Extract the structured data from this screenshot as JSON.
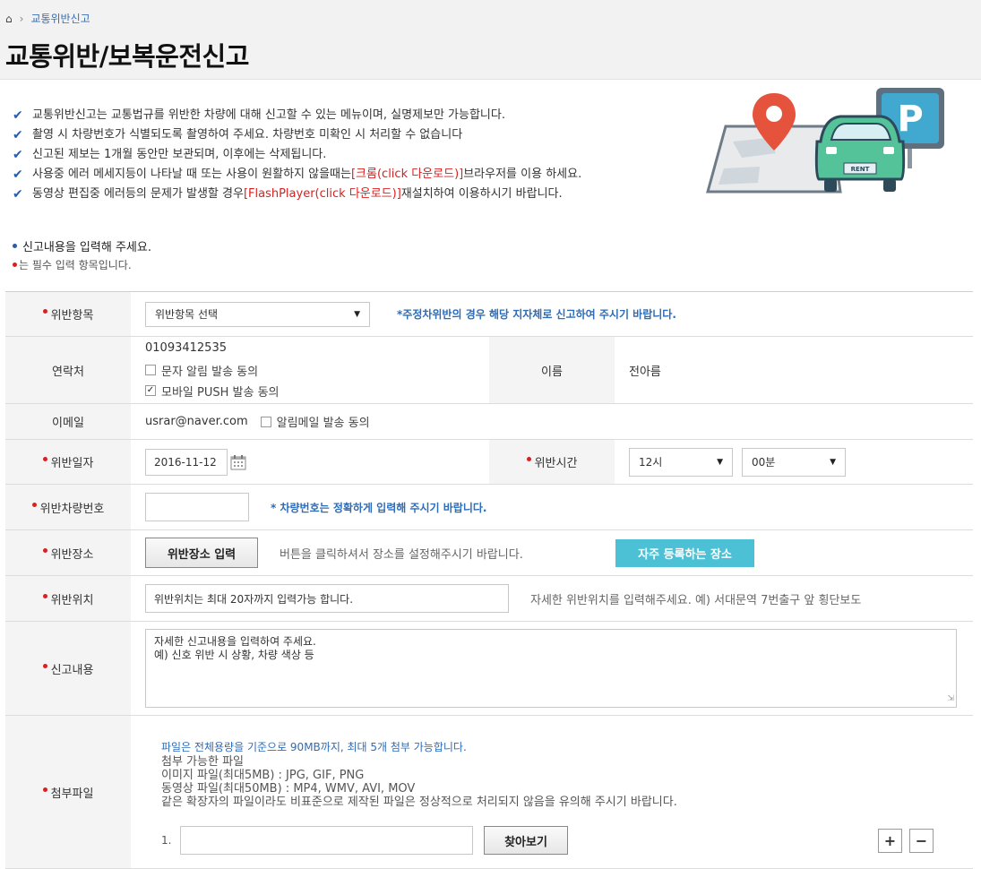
{
  "breadcrumb": {
    "current": "교통위반신고"
  },
  "page_title": "교통위반/보복운전신고",
  "notices": [
    {
      "text": "교통위반신고는 교통법규를 위반한 차량에 대해 신고할 수 있는 메뉴이며, 실명제보만 가능합니다."
    },
    {
      "text": "촬영 시 차량번호가 식별되도록 촬영하여 주세요. 차량번호 미확인 시 처리할 수 없습니다"
    },
    {
      "text": "신고된 제보는 1개월 동안만 보관되며, 이후에는 삭제됩니다."
    },
    {
      "pre": "사용중 에러 메세지등이 나타날 때 또는 사용이 원활하지 않을때는 ",
      "link": "[크롬(click 다운로드)]",
      "post": "브라우저를 이용 하세요."
    },
    {
      "pre": "동영상 편집중 에러등의 문제가 발생할 경우 ",
      "link": "[FlashPlayer(click 다운로드)]",
      "post": "재설치하여 이용하시기 바랍니다."
    }
  ],
  "illustration": {
    "car_plate": "RENT",
    "parking_sign": "P"
  },
  "intro": {
    "line1": "신고내용을 입력해 주세요.",
    "line2": "는 필수 입력 항목입니다."
  },
  "form": {
    "violation_item": {
      "label": "위반항목",
      "select_value": "위반항목 선택",
      "note": "*주정차위반의 경우 해당 지자체로 신고하여 주시기 바랍니다."
    },
    "contact": {
      "label": "연락처",
      "phone": "01093412535",
      "sms_consent": "문자 알림 발송 동의",
      "push_consent": "모바일 PUSH 발송 동의",
      "name_label": "이름",
      "name_value": "전아름"
    },
    "email": {
      "label": "이메일",
      "value": "usrar@naver.com",
      "consent": "알림메일 발송 동의"
    },
    "violation_date": {
      "label": "위반일자",
      "value": "2016-11-12",
      "time_label": "위반시간",
      "hour": "12시",
      "minute": "00분"
    },
    "plate_number": {
      "label": "위반차량번호",
      "note": "* 차량번호는 정확하게 입력해 주시기 바랍니다."
    },
    "location": {
      "label": "위반장소",
      "button": "위반장소 입력",
      "hint": "버튼을 클릭하셔서 장소를 설정해주시기 바랍니다.",
      "favorite_button": "자주 등록하는 장소"
    },
    "position": {
      "label": "위반위치",
      "placeholder": "위반위치는 최대 20자까지 입력가능 합니다.",
      "hint": "자세한 위반위치를 입력해주세요. 예) 서대문역 7번출구 앞 횡단보도"
    },
    "content": {
      "label": "신고내용",
      "line1": "자세한 신고내용을 입력하여 주세요.",
      "line2": "예) 신호 위반 시 상황, 차량 색상 등"
    },
    "attachment": {
      "label": "첨부파일",
      "notice": "파일은 전체용량을 기준으로 90MB까지, 최대 5개 첨부 가능합니다.",
      "line1": "첨부 가능한 파일",
      "line2": "이미지 파일(최대5MB) : JPG, GIF, PNG",
      "line3": "동영상 파일(최대50MB) : MP4, WMV, AVI, MOV",
      "line4": "같은 확장자의 파일이라도 비표준으로 제작된 파일은 정상적으로 처리되지 않음을 유의해 주시기 바랍니다.",
      "index": "1.",
      "browse_button": "찾아보기",
      "add": "+",
      "remove": "−"
    }
  },
  "colors": {
    "accent_blue": "#2d6db8",
    "required_red": "#d92020",
    "teal_button": "#4cc0d4"
  }
}
